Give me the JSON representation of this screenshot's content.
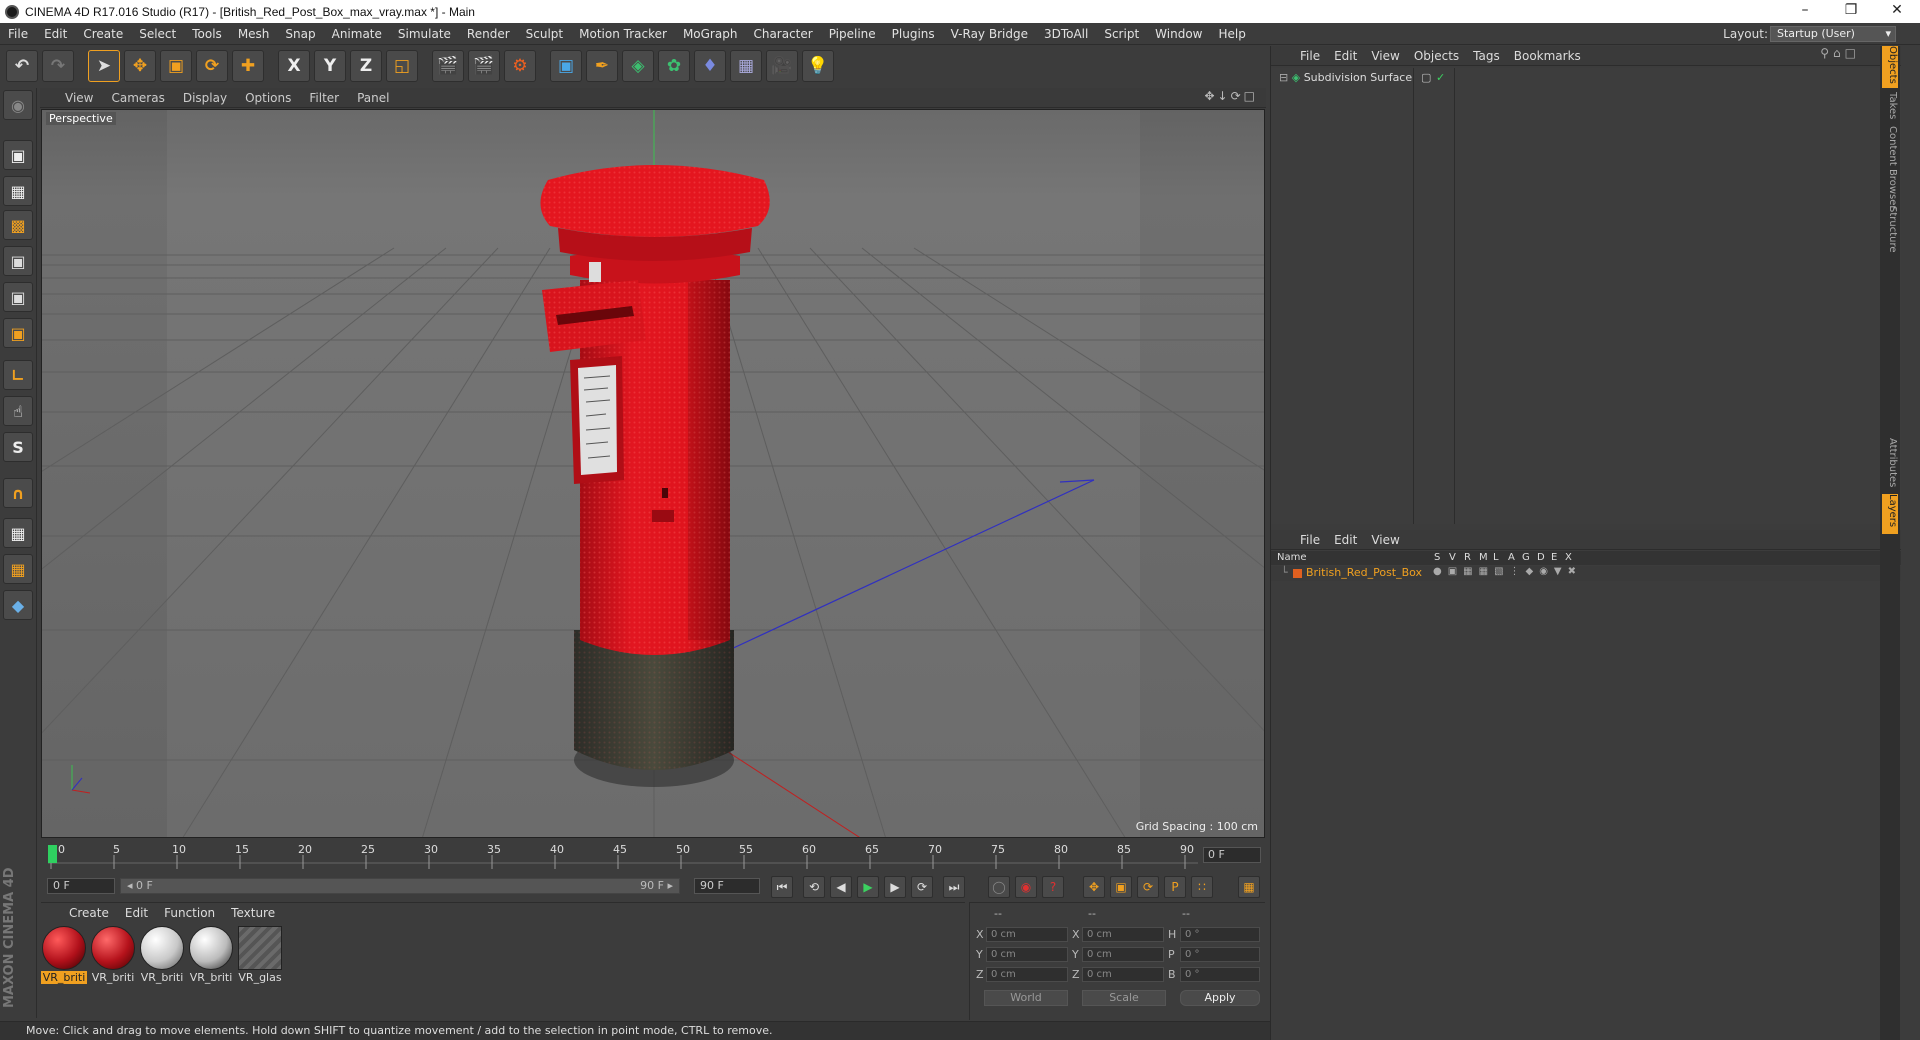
{
  "title_bar": {
    "title": "CINEMA 4D R17.016 Studio (R17) - [British_Red_Post_Box_max_vray.max *] - Main",
    "minimize": "–",
    "maximize": "❐",
    "close": "✕"
  },
  "menu": [
    "File",
    "Edit",
    "Create",
    "Select",
    "Tools",
    "Mesh",
    "Snap",
    "Animate",
    "Simulate",
    "Render",
    "Sculpt",
    "Motion Tracker",
    "MoGraph",
    "Character",
    "Pipeline",
    "Plugins",
    "V-Ray Bridge",
    "3DToAll",
    "Script",
    "Window",
    "Help"
  ],
  "layout": {
    "label": "Layout:",
    "value": "Startup (User)"
  },
  "toolbar": {
    "x_label": "X",
    "y_label": "Y",
    "z_label": "Z"
  },
  "viewport": {
    "menu": [
      "View",
      "Cameras",
      "Display",
      "Options",
      "Filter",
      "Panel"
    ],
    "label": "Perspective",
    "grid_spacing": "Grid Spacing : 100 cm"
  },
  "timeline": {
    "ticks": [
      "0",
      "5",
      "10",
      "15",
      "20",
      "25",
      "30",
      "35",
      "40",
      "45",
      "50",
      "55",
      "60",
      "65",
      "70",
      "75",
      "80",
      "85",
      "90"
    ],
    "end_frame": "0 F",
    "current": "0 F",
    "slider_start": "◂ 0 F",
    "slider_end": "90 F ▸",
    "max": "90 F"
  },
  "materials": {
    "menu": [
      "Create",
      "Edit",
      "Function",
      "Texture"
    ],
    "items": [
      {
        "label": "VR_briti",
        "color": "#c0141e",
        "selected": true
      },
      {
        "label": "VR_briti",
        "color": "#b5121b",
        "selected": false
      },
      {
        "label": "VR_briti",
        "color": "#dcdcdc",
        "selected": false
      },
      {
        "label": "VR_briti",
        "color": "#d0d0d0",
        "selected": false
      },
      {
        "label": "VR_glas",
        "color": "#606060",
        "selected": false
      }
    ]
  },
  "coords": {
    "headers": [
      "--",
      "--",
      "--"
    ],
    "rows": [
      {
        "a": "X",
        "v1": "0 cm",
        "b": "X",
        "v2": "0 cm",
        "c": "H",
        "v3": "0 °"
      },
      {
        "a": "Y",
        "v1": "0 cm",
        "b": "Y",
        "v2": "0 cm",
        "c": "P",
        "v3": "0 °"
      },
      {
        "a": "Z",
        "v1": "0 cm",
        "b": "Z",
        "v2": "0 cm",
        "c": "B",
        "v3": "0 °"
      }
    ],
    "world": "World",
    "scale": "Scale",
    "apply": "Apply"
  },
  "status": "Move: Click and drag to move elements. Hold down SHIFT to quantize movement / add to the selection in point mode, CTRL to remove.",
  "objects_panel": {
    "menu": [
      "File",
      "Edit",
      "View",
      "Objects",
      "Tags",
      "Bookmarks"
    ],
    "object": "Subdivision Surface"
  },
  "layers_panel": {
    "menu": [
      "File",
      "Edit",
      "View"
    ],
    "columns": [
      "Name",
      "S",
      "V",
      "R",
      "M",
      "L",
      "A",
      "G",
      "D",
      "E",
      "X"
    ],
    "layer": "British_Red_Post_Box"
  },
  "side_tabs": [
    "Objects",
    "Takes",
    "Content Browser",
    "Structure",
    "Attributes",
    "Layers"
  ],
  "maxon": "MAXON CINEMA 4D",
  "colors": {
    "accent": "#f0a020",
    "postbox": "#d8101a"
  }
}
